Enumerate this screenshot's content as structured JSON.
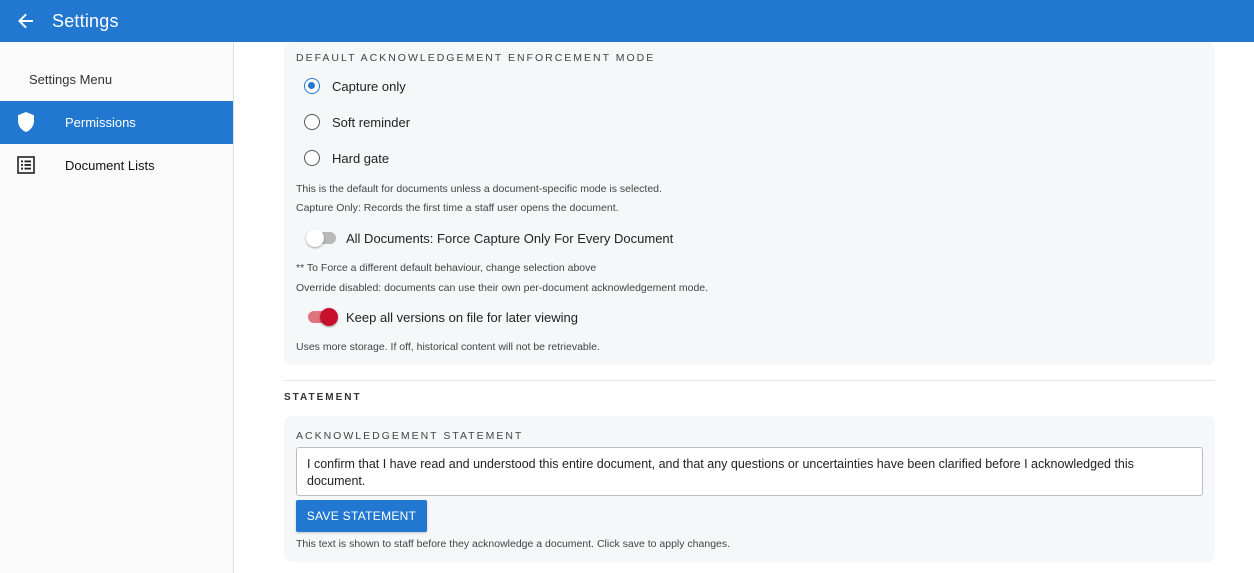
{
  "appbar": {
    "title": "Settings",
    "back_icon": "arrow-left-icon"
  },
  "sidebar": {
    "menu_title": "Settings Menu",
    "items": [
      {
        "label": "Permissions",
        "icon": "shield-icon",
        "active": true
      },
      {
        "label": "Document Lists",
        "icon": "list-icon",
        "active": false
      }
    ]
  },
  "enforcement": {
    "heading": "DEFAULT ACKNOWLEDGEMENT ENFORCEMENT MODE",
    "options": [
      {
        "label": "Capture only",
        "selected": true
      },
      {
        "label": "Soft reminder",
        "selected": false
      },
      {
        "label": "Hard gate",
        "selected": false
      }
    ],
    "hint1": "This is the default for documents unless a document-specific mode is selected.",
    "hint2": "Capture Only: Records the first time a staff user opens the document.",
    "force_toggle": {
      "label": "All Documents: Force Capture Only For Every Document",
      "on": false
    },
    "hint3": "** To Force a different default behaviour, change selection above",
    "hint4": "Override disabled: documents can use their own per-document acknowledgement mode.",
    "versions_toggle": {
      "label": "Keep all versions on file for later viewing",
      "on": true
    },
    "hint5": "Uses more storage. If off, historical content will not be retrievable."
  },
  "statement": {
    "section_title": "STATEMENT",
    "heading": "ACKNOWLEDGEMENT STATEMENT",
    "value": "I confirm that I have read and understood this entire document, and that any questions or uncertainties have been clarified before I acknowledged this document.",
    "save_label": "SAVE STATEMENT",
    "hint": "This text is shown to staff before they acknowledge a document. Click save to apply changes."
  },
  "colors": {
    "primary": "#2277d0",
    "toggle_on": "#c8102e"
  }
}
